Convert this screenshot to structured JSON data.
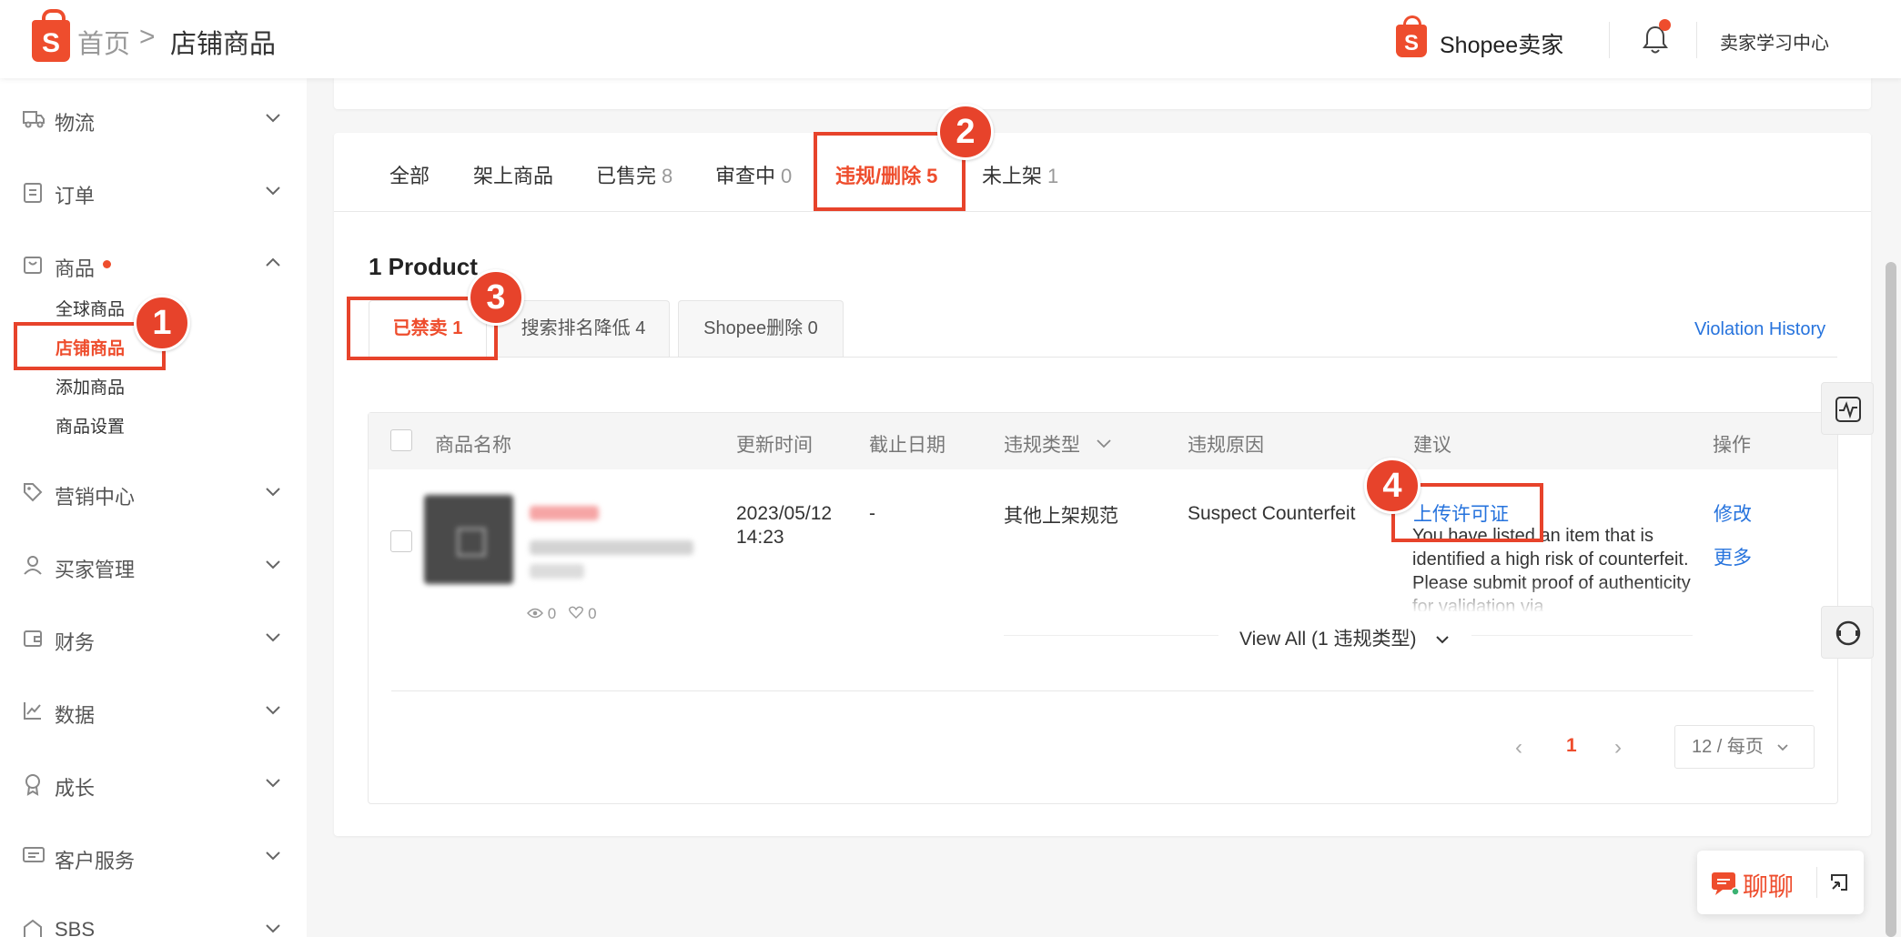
{
  "header": {
    "logo_letter": "S",
    "breadcrumb": {
      "home": "首页",
      "separator": ">",
      "current": "店铺商品"
    },
    "seller_logo_letter": "S",
    "seller_name": "Shopee卖家",
    "learning_center": "卖家学习中心"
  },
  "sidebar": {
    "items": [
      {
        "label": "物流",
        "icon": "truck-icon"
      },
      {
        "label": "订单",
        "icon": "clipboard-icon"
      },
      {
        "label": "商品",
        "icon": "bag-icon",
        "expanded": true,
        "has_dot": true
      },
      {
        "label": "营销中心",
        "icon": "tag-icon"
      },
      {
        "label": "买家管理",
        "icon": "user-icon"
      },
      {
        "label": "财务",
        "icon": "wallet-icon"
      },
      {
        "label": "数据",
        "icon": "chart-icon"
      },
      {
        "label": "成长",
        "icon": "medal-icon"
      },
      {
        "label": "客户服务",
        "icon": "message-icon"
      },
      {
        "label": "SBS",
        "icon": "warehouse-icon"
      }
    ],
    "product_submenu": [
      {
        "label": "全球商品"
      },
      {
        "label": "店铺商品",
        "active": true
      },
      {
        "label": "添加商品"
      },
      {
        "label": "商品设置"
      }
    ]
  },
  "tabs": [
    {
      "label": "全部",
      "count": ""
    },
    {
      "label": "架上商品",
      "count": ""
    },
    {
      "label": "已售完",
      "count": "8"
    },
    {
      "label": "审查中",
      "count": "0"
    },
    {
      "label": "违规/删除",
      "count": "5",
      "active": true
    },
    {
      "label": "未上架",
      "count": "1"
    }
  ],
  "product_count": "1 Product",
  "subtabs": [
    {
      "label": "已禁卖 1",
      "active": true
    },
    {
      "label": "搜索排名降低 4"
    },
    {
      "label": "Shopee删除 0"
    }
  ],
  "violation_history": "Violation History",
  "table": {
    "headers": {
      "name": "商品名称",
      "updated": "更新时间",
      "deadline": "截止日期",
      "violation_type": "违规类型",
      "violation_reason": "违规原因",
      "suggestion": "建议",
      "actions": "操作"
    },
    "rows": [
      {
        "views": "0",
        "likes": "0",
        "updated_date": "2023/05/12",
        "updated_time": "14:23",
        "deadline": "-",
        "violation_type": "其他上架规范",
        "violation_reason": "Suspect Counterfeit",
        "suggestion_link": "上传许可证",
        "suggestion_text": "You have listed an item that is identified a high risk of counterfeit. Please submit proof of authenticity for validation via",
        "actions": [
          "修改",
          "更多"
        ]
      }
    ],
    "view_all": "View All (1 违规类型)"
  },
  "pagination": {
    "current_page": "1",
    "page_size": "12 / 每页"
  },
  "chat": {
    "label": "聊聊"
  },
  "annotations": [
    "1",
    "2",
    "3",
    "4"
  ],
  "colors": {
    "brand": "#ee4d2d",
    "link": "#2673dd",
    "annotation": "#e7432b"
  }
}
